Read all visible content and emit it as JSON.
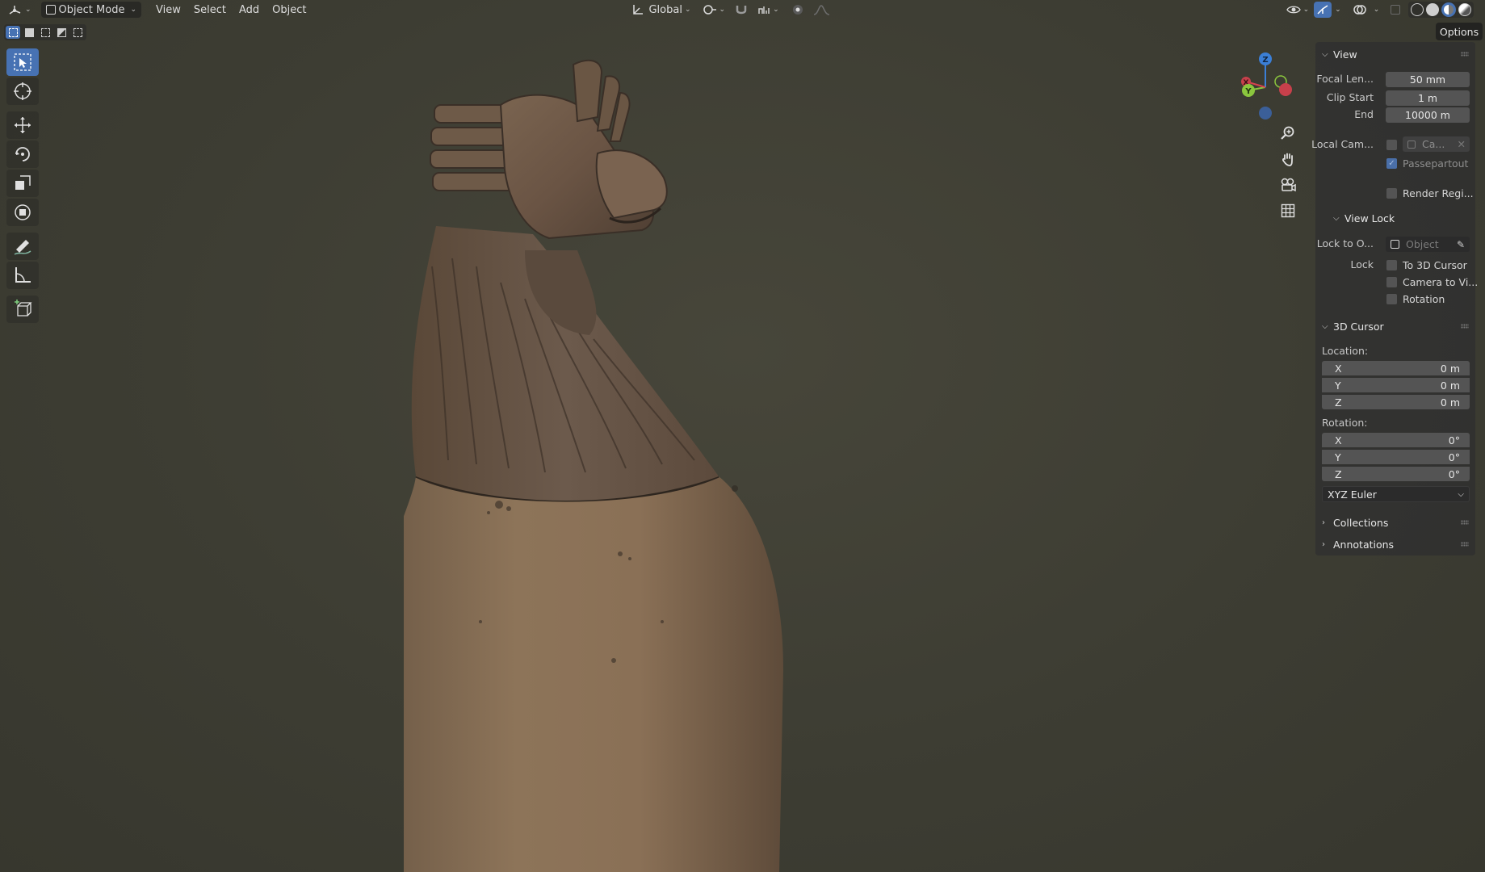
{
  "header": {
    "mode_label": "Object Mode",
    "menus": [
      "View",
      "Select",
      "Add",
      "Object"
    ],
    "transform_orientation": "Global"
  },
  "options_label": "Options",
  "gizmo_axes": {
    "x": "X",
    "y": "Y",
    "z": "Z"
  },
  "sidebar": {
    "view": {
      "title": "View",
      "focal_length_label": "Focal Len...",
      "focal_length_value": "50 mm",
      "clip_start_label": "Clip Start",
      "clip_start_value": "1 m",
      "end_label": "End",
      "end_value": "10000 m",
      "local_camera_label": "Local Cam...",
      "local_camera_value": "Ca...",
      "passepartout_label": "Passepartout",
      "render_region_label": "Render Regi..."
    },
    "view_lock": {
      "title": "View Lock",
      "lock_to_object_label": "Lock to O...",
      "lock_to_object_placeholder": "Object",
      "lock_label": "Lock",
      "to_3d_cursor_label": "To 3D Cursor",
      "camera_to_view_label": "Camera to Vi...",
      "rotation_label": "Rotation"
    },
    "cursor": {
      "title": "3D Cursor",
      "location_label": "Location:",
      "location": [
        {
          "axis": "X",
          "value": "0 m"
        },
        {
          "axis": "Y",
          "value": "0 m"
        },
        {
          "axis": "Z",
          "value": "0 m"
        }
      ],
      "rotation_label": "Rotation:",
      "rotation": [
        {
          "axis": "X",
          "value": "0°"
        },
        {
          "axis": "Y",
          "value": "0°"
        },
        {
          "axis": "Z",
          "value": "0°"
        }
      ],
      "rotation_mode": "XYZ Euler"
    },
    "collections_title": "Collections",
    "annotations_title": "Annotations"
  },
  "colors": {
    "accent": "#4772b3",
    "viewport_bg": "#3d3d33",
    "axis_x": "#d8434e",
    "axis_y": "#8bc63e",
    "axis_z": "#3b7fd6"
  }
}
